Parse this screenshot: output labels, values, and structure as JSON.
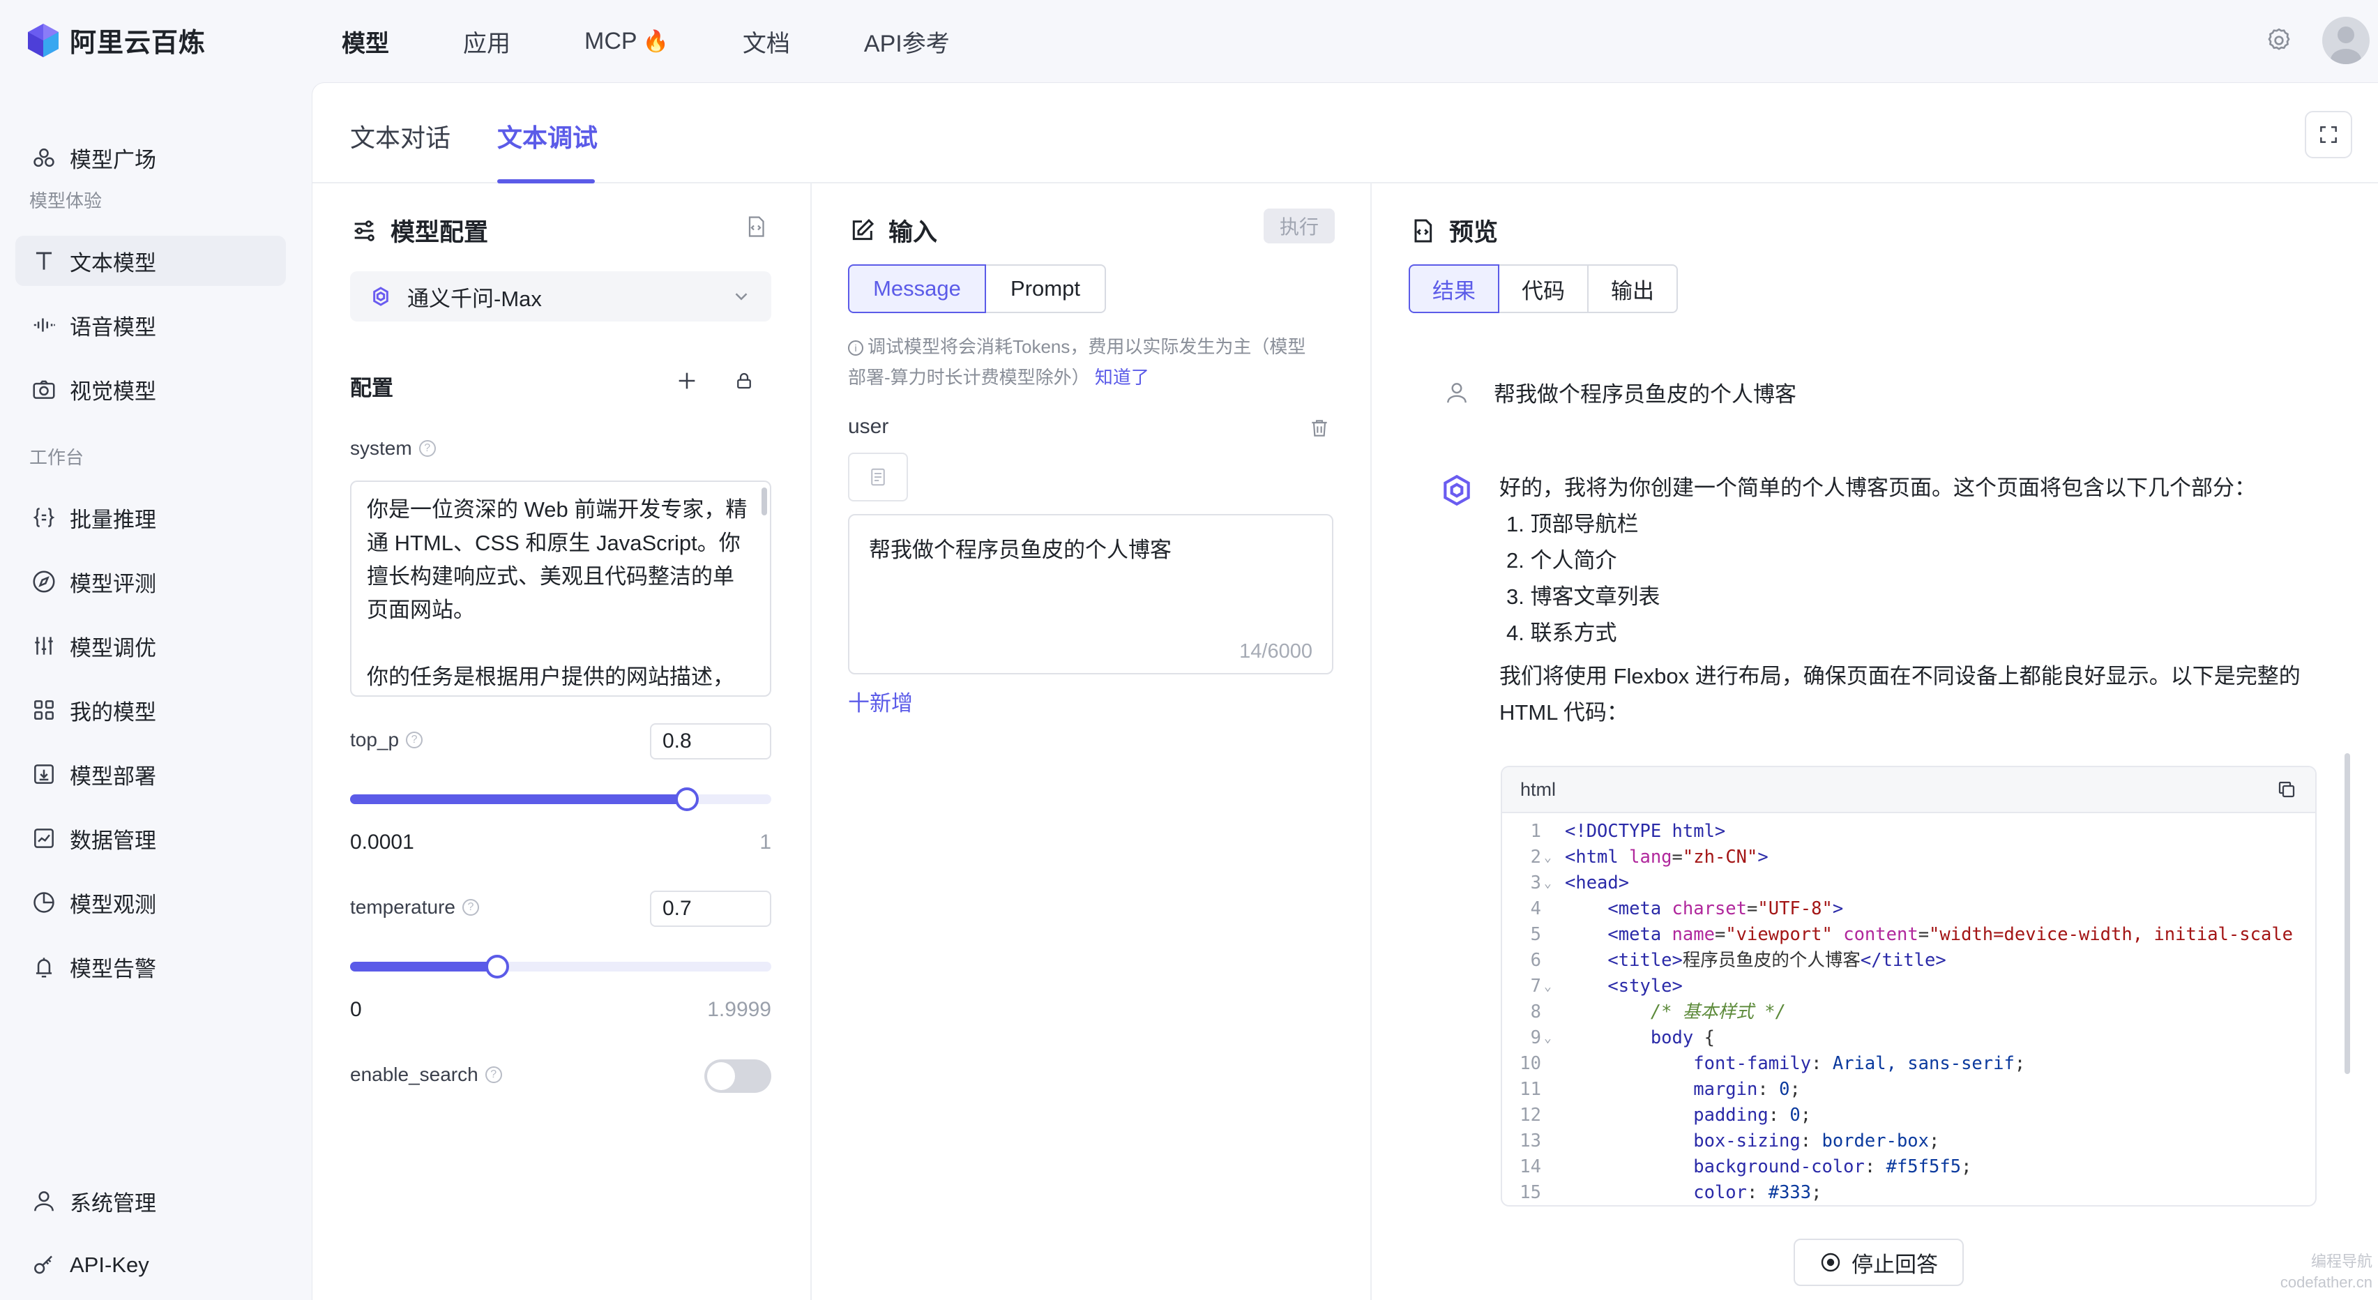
{
  "brand": {
    "name": "阿里云百炼"
  },
  "topnav": {
    "items": [
      {
        "label": "模型"
      },
      {
        "label": "应用"
      },
      {
        "label": "MCP"
      },
      {
        "label": "文档"
      },
      {
        "label": "API参考"
      }
    ]
  },
  "sidebar": {
    "model_square": "模型广场",
    "group_experience": "模型体验",
    "text_model": "文本模型",
    "speech_model": "语音模型",
    "vision_model": "视觉模型",
    "group_workbench": "工作台",
    "batch_inference": "批量推理",
    "model_eval": "模型评测",
    "model_tuning": "模型调优",
    "my_models": "我的模型",
    "model_deploy": "模型部署",
    "data_mgmt": "数据管理",
    "model_observe": "模型观测",
    "model_alert": "模型告警",
    "system_mgmt": "系统管理",
    "api_key": "API-Key"
  },
  "tabs": {
    "chat": "文本对话",
    "debug": "文本调试"
  },
  "config_panel": {
    "title": "模型配置",
    "model_name": "通义千问-Max",
    "section_title": "配置",
    "system_label": "system",
    "system_text": "你是一位资深的 Web 前端开发专家，精通 HTML、CSS 和原生 JavaScript。你擅长构建响应式、美观且代码整洁的单页面网站。\n\n你的任务是根据用户提供的网站描述，",
    "top_p": {
      "label": "top_p",
      "value": "0.8",
      "min": "0.0001",
      "max": "1",
      "fraction": 0.8
    },
    "temperature": {
      "label": "temperature",
      "value": "0.7",
      "min": "0",
      "max": "1.9999",
      "fraction": 0.35
    },
    "enable_search": {
      "label": "enable_search",
      "on": false
    }
  },
  "input_panel": {
    "title": "输入",
    "exec_label": "执行",
    "seg_message": "Message",
    "seg_prompt": "Prompt",
    "notice": "调试模型将会消耗Tokens，费用以实际发生为主（模型部署-算力时长计费模型除外）",
    "notice_link": "知道了",
    "role": "user",
    "message_text": "帮我做个程序员鱼皮的个人博客",
    "counter": "14/6000",
    "add_label": "十新增"
  },
  "preview_panel": {
    "title": "预览",
    "seg_result": "结果",
    "seg_code": "代码",
    "seg_output": "输出",
    "user_msg": "帮我做个程序员鱼皮的个人博客",
    "ai_intro": "好的，我将为你创建一个简单的个人博客页面。这个页面将包含以下几个部分：",
    "ai_list": [
      "1.  顶部导航栏",
      "2.  个人简介",
      "3.  博客文章列表",
      "4.  联系方式"
    ],
    "ai_outro": "我们将使用 Flexbox 进行布局，确保页面在不同设备上都能良好显示。以下是完整的HTML 代码：",
    "code_lang": "html",
    "code_lines": [
      {
        "n": "1",
        "fold": "",
        "html": "<span class='tag'>&lt;!DOCTYPE html&gt;</span>"
      },
      {
        "n": "2",
        "fold": "⌄",
        "html": "<span class='tag'>&lt;html</span> <span class='attr'>lang</span>=<span class='str'>\"zh-CN\"</span><span class='tag'>&gt;</span>"
      },
      {
        "n": "3",
        "fold": "⌄",
        "html": "<span class='tag'>&lt;head&gt;</span>"
      },
      {
        "n": "4",
        "fold": "",
        "html": "    <span class='tag'>&lt;meta</span> <span class='attr'>charset</span>=<span class='str'>\"UTF-8\"</span><span class='tag'>&gt;</span>"
      },
      {
        "n": "5",
        "fold": "",
        "html": "    <span class='tag'>&lt;meta</span> <span class='attr'>name</span>=<span class='str'>\"viewport\"</span> <span class='attr'>content</span>=<span class='str'>\"width=device-width, initial-scale</span>"
      },
      {
        "n": "6",
        "fold": "",
        "html": "    <span class='tag'>&lt;title&gt;</span>程序员鱼皮的个人博客<span class='tag'>&lt;/title&gt;</span>"
      },
      {
        "n": "7",
        "fold": "⌄",
        "html": "    <span class='tag'>&lt;style&gt;</span>"
      },
      {
        "n": "8",
        "fold": "",
        "html": "        <span class='cmt'>/* 基本样式 */</span>"
      },
      {
        "n": "9",
        "fold": "⌄",
        "html": "        <span class='tag'>body</span> {"
      },
      {
        "n": "10",
        "fold": "",
        "html": "            <span class='prop'>font-family</span>: <span class='val'>Arial, sans-serif</span>;"
      },
      {
        "n": "11",
        "fold": "",
        "html": "            <span class='prop'>margin</span>: <span class='val'>0</span>;"
      },
      {
        "n": "12",
        "fold": "",
        "html": "            <span class='prop'>padding</span>: <span class='val'>0</span>;"
      },
      {
        "n": "13",
        "fold": "",
        "html": "            <span class='prop'>box-sizing</span>: <span class='val'>border-box</span>;"
      },
      {
        "n": "14",
        "fold": "",
        "html": "            <span class='prop'>background-color</span>: <span class='val'>#f5f5f5</span>;"
      },
      {
        "n": "15",
        "fold": "",
        "html": "            <span class='prop'>color</span>: <span class='val'>#333</span>;"
      }
    ],
    "stop_label": "停止回答"
  },
  "watermark": {
    "line1": "编程导航",
    "line2": "codefather.cn"
  },
  "colors": {
    "accent": "#5b5be8",
    "bg": "#f6f7fb",
    "panel": "#ffffff"
  }
}
